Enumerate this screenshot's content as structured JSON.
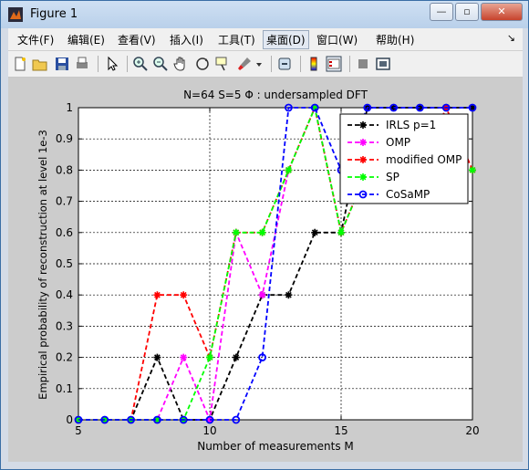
{
  "window": {
    "title": "Figure 1"
  },
  "window_buttons": {
    "minimize": "—",
    "maximize": "▫",
    "close": "✕"
  },
  "menu": {
    "items": [
      "文件(F)",
      "编辑(E)",
      "查看(V)",
      "插入(I)",
      "工具(T)",
      "桌面(D)",
      "窗口(W)",
      "帮助(H)"
    ],
    "active": "桌面(D)",
    "dock_arrow": "↘"
  },
  "toolbar": {
    "icons": [
      "new-figure-icon",
      "open-icon",
      "save-icon",
      "print-icon",
      "edit-plot-arrow-icon",
      "zoom-in-icon",
      "zoom-out-icon",
      "pan-hand-icon",
      "rotate-3d-icon",
      "data-cursor-icon",
      "brush-icon",
      "link-plot-icon",
      "colorbar-icon",
      "legend-icon",
      "hide-plot-tools-icon",
      "show-plot-tools-icon"
    ]
  },
  "chart_data": {
    "type": "line",
    "title": "N=64 S=5 Φ : undersampled DFT",
    "xlabel": "Number of measurements M",
    "ylabel": "Empirical probability of reconstruction at level 1e-3",
    "xlim": [
      5,
      20
    ],
    "ylim": [
      0,
      1
    ],
    "xticks": [
      5,
      10,
      15,
      20
    ],
    "yticks": [
      0,
      0.1,
      0.2,
      0.3,
      0.4,
      0.5,
      0.6,
      0.7,
      0.8,
      0.9,
      1
    ],
    "grid": true,
    "legend_position": "top-right",
    "x": [
      5,
      6,
      7,
      8,
      9,
      10,
      11,
      12,
      13,
      14,
      15,
      16,
      17,
      18,
      19,
      20
    ],
    "series": [
      {
        "name": "IRLS p=1",
        "color": "#000000",
        "marker": "star",
        "values": [
          0,
          0,
          0,
          0.2,
          0,
          0,
          0.2,
          0.4,
          0.4,
          0.6,
          0.6,
          1,
          1,
          1,
          1,
          1
        ]
      },
      {
        "name": "OMP",
        "color": "#ff00ff",
        "marker": "star",
        "values": [
          0,
          0,
          0,
          0,
          0.2,
          0,
          0.6,
          0.4,
          0.8,
          1,
          0.6,
          0.8,
          0.8,
          0.8,
          0.8,
          0.8
        ]
      },
      {
        "name": "modified OMP",
        "color": "#ff0000",
        "marker": "star",
        "values": [
          0,
          0,
          0,
          0.4,
          0.4,
          0.2,
          0.6,
          0.6,
          0.8,
          1,
          0.6,
          0.8,
          0.8,
          0.8,
          1,
          0.8
        ]
      },
      {
        "name": "SP",
        "color": "#00ff00",
        "marker": "star",
        "values": [
          0,
          0,
          0,
          0,
          0,
          0.2,
          0.6,
          0.6,
          0.8,
          1,
          0.6,
          0.8,
          0.8,
          0.8,
          0.8,
          0.8
        ]
      },
      {
        "name": "CoSaMP",
        "color": "#0000ff",
        "marker": "circle",
        "values": [
          0,
          0,
          0,
          0,
          0,
          0,
          0,
          0.2,
          1,
          1,
          0.8,
          1,
          1,
          1,
          1,
          1
        ]
      }
    ]
  }
}
